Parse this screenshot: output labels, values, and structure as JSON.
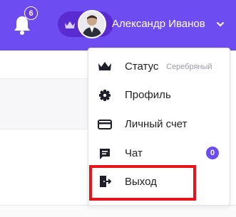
{
  "header": {
    "notifications": {
      "icon": "bell-icon",
      "count": "6"
    },
    "user": {
      "name": "Александр Иванов",
      "badge_icon": "crown-icon",
      "avatar": "user-avatar",
      "chevron_icon": "chevron-down-icon"
    },
    "colors": {
      "bar": "#6d4df2",
      "pill": "#5a2bd0",
      "badge": "#6a3fe0"
    }
  },
  "menu": {
    "items": [
      {
        "label": "Статус",
        "icon": "crown-icon",
        "value": "Серебряный"
      },
      {
        "label": "Профиль",
        "icon": "gear-icon"
      },
      {
        "label": "Личный счет",
        "icon": "credit-card-icon"
      },
      {
        "label": "Чат",
        "icon": "chat-icon",
        "badge": "0"
      },
      {
        "label": "Выход",
        "icon": "logout-icon"
      }
    ],
    "highlight_color": "#e8141c"
  }
}
